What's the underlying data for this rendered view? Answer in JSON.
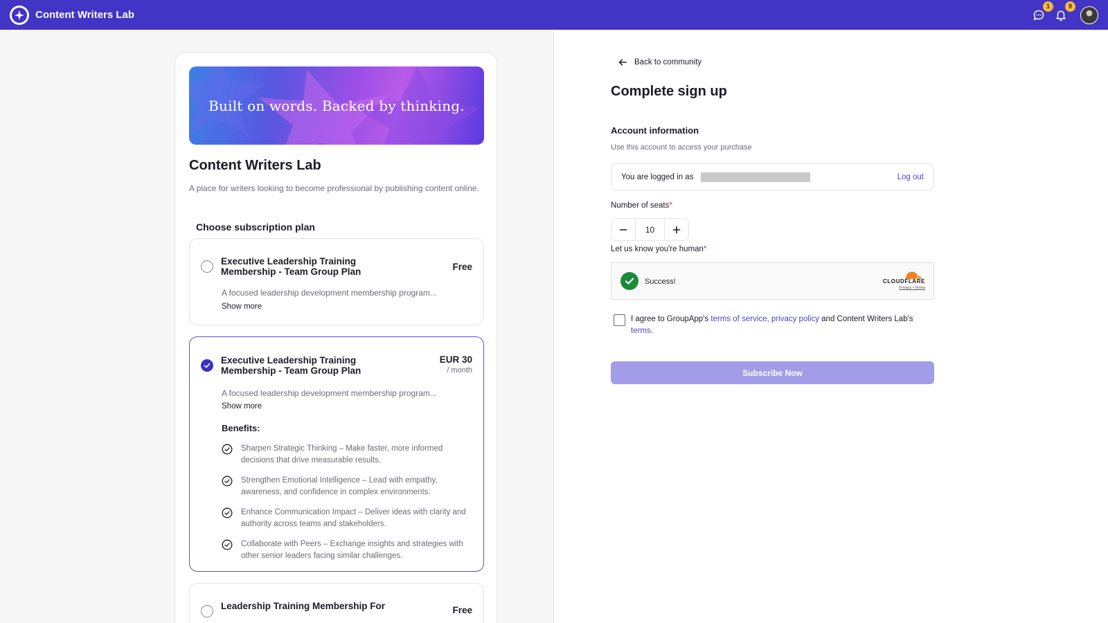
{
  "app": {
    "title": "Content Writers Lab"
  },
  "topbar": {
    "icons": [
      "chat-icon",
      "bell-icon"
    ],
    "chat_badge": "1",
    "notifications_badge": "9"
  },
  "community": {
    "banner_text": "Built on words. Backed by thinking.",
    "name": "Content Writers Lab",
    "description": "A place for writers looking to become professional by publishing content online.",
    "choose_plan_label": "Choose subscription plan"
  },
  "plans": [
    {
      "name": "Executive Leadership Training Membership - Team Group Plan",
      "price": "Free",
      "description": "A focused leadership development membership program...",
      "show_more": "Show more",
      "selected": false
    },
    {
      "name": "Executive Leadership Training Membership - Team Group Plan",
      "price": "EUR 30",
      "period": "/ month",
      "description": "A focused leadership development membership program...",
      "show_more": "Show more",
      "selected": true,
      "benefits_title": "Benefits:",
      "benefits": [
        "Sharpen Strategic Thinking – Make faster, more informed decisions that drive measurable results.",
        "Strengthen Emotional Intelligence – Lead with empathy, awareness, and confidence in complex environments.",
        "Enhance Communication Impact – Deliver ideas with clarity and authority across teams and stakeholders.",
        "Collaborate with Peers – Exchange insights and strategies with other senior leaders facing similar challenges."
      ]
    },
    {
      "name": "Leadership Training Membership For",
      "price": "Free",
      "selected": false
    }
  ],
  "signup": {
    "back_label": "Back to community",
    "title": "Complete sign up",
    "account_title": "Account information",
    "account_sub": "Use this account to access your purchase",
    "logged_in_as": "You are logged in as",
    "logout": "Log out",
    "seats_label": "Number of seats",
    "seats_value": "10",
    "human_label": "Let us know you're human",
    "captcha_status": "Success!",
    "captcha_brand": "CLOUDFLARE",
    "captcha_links": "Privacy • Terms",
    "agree_prefix": "I agree to GroupApp's",
    "agree_tos": "terms of service,",
    "agree_privacy": "privacy policy",
    "agree_middle": "and Content Writers Lab's",
    "agree_terms": "terms",
    "agree_suffix": ".",
    "required_mark": "*",
    "subscribe_label": "Subscribe Now"
  },
  "colors": {
    "brand": "#4234c4",
    "accent": "#3b2fc4",
    "link": "#4a45c9",
    "subscribe_disabled": "#a39ce6",
    "badge": "#f5b93a",
    "captcha_success": "#1d8a3a"
  }
}
